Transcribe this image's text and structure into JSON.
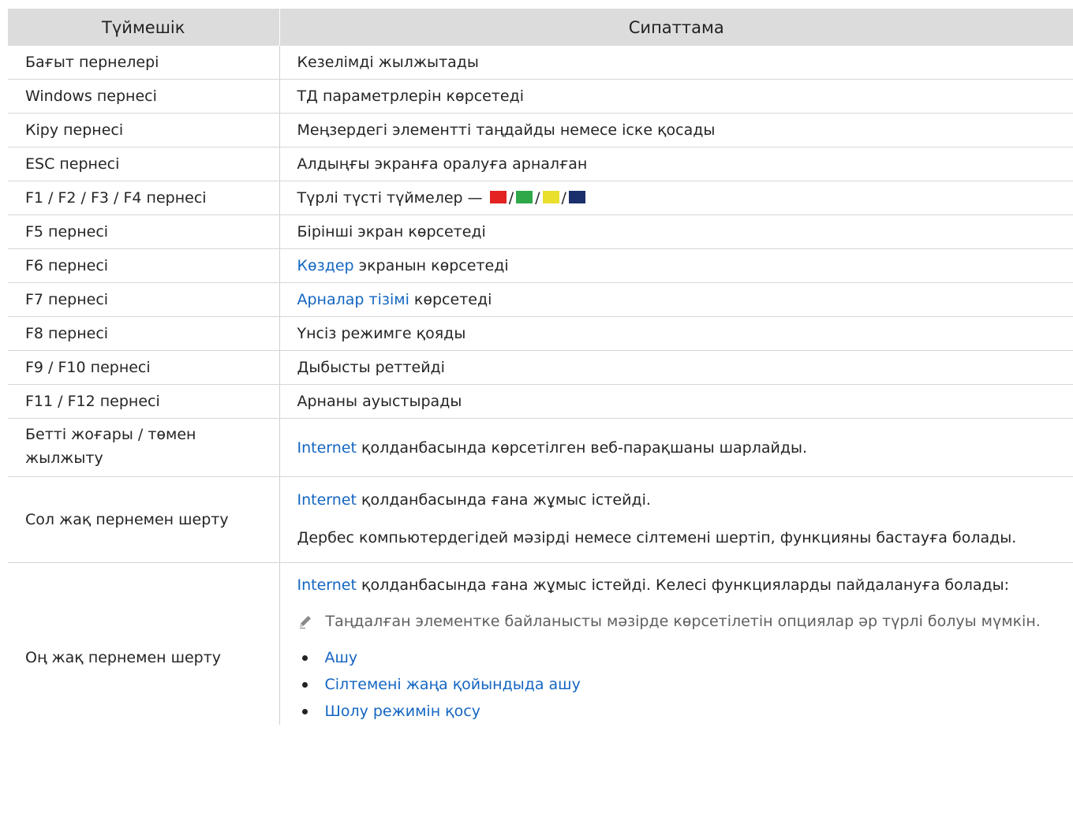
{
  "header": {
    "col1": "Түймешік",
    "col2": "Сипаттама"
  },
  "rows": [
    {
      "key": "Бағыт пернелері",
      "desc": "Кезелімді жылжытады"
    },
    {
      "key": "Windows пернесі",
      "desc": "ТД параметрлерін көрсетеді"
    },
    {
      "key": "Кіру пернесі",
      "desc": "Меңзердегі элементті таңдайды немесе іске қосады"
    },
    {
      "key": "ESC пернесі",
      "desc": "Алдыңғы экранға оралуға арналған"
    },
    {
      "key": "F1 / F2 / F3 / F4 пернесі",
      "desc_prefix": "Түрлі түсті түймелер — ",
      "separator": "/"
    },
    {
      "key": "F5 пернесі",
      "desc": "Бірінші экран көрсетеді"
    },
    {
      "key": "F6 пернесі",
      "link": "Көздер",
      "desc_suffix": " экранын көрсетеді"
    },
    {
      "key": "F7 пернесі",
      "link": "Арналар тізімі",
      "desc_suffix": " көрсетеді"
    },
    {
      "key": "F8 пернесі",
      "desc": "Үнсіз режимге қояды"
    },
    {
      "key": "F9 / F10 пернесі",
      "desc": "Дыбысты реттейді"
    },
    {
      "key": "F11 / F12 пернесі",
      "desc": "Арнаны ауыстырады"
    },
    {
      "key": "Бетті жоғары / төмен жылжыту",
      "link": "Internet",
      "desc_suffix": " қолданбасында көрсетілген веб-парақшаны шарлайды."
    },
    {
      "key": "Сол жақ пернемен шерту",
      "link": "Internet",
      "desc_suffix": " қолданбасында ғана жұмыс істейді.",
      "desc2": "Дербес компьютердегідей мәзірді немесе сілтемені шертіп, функцияны бастауға болады."
    },
    {
      "key": "Оң жақ пернемен шерту",
      "link": "Internet",
      "desc_suffix": " қолданбасында ғана жұмыс істейді. Келесі функцияларды пайдалануға болады:",
      "note": "Таңдалған элементке байланысты мәзірде көрсетілетін опциялар әр түрлі болуы мүмкін.",
      "bullets": [
        "Ашу",
        "Сілтемені жаңа қойындыда ашу",
        "Шолу режимін қосу"
      ]
    }
  ],
  "swatches": [
    "#e32222",
    "#2fa84a",
    "#e9df2c",
    "#1a2f6b"
  ],
  "colors": {
    "link": "#1466c1",
    "header_bg": "#dcdcdc"
  },
  "icons": {
    "note": "pencil-note-icon",
    "bullet": "bullet-dot"
  }
}
